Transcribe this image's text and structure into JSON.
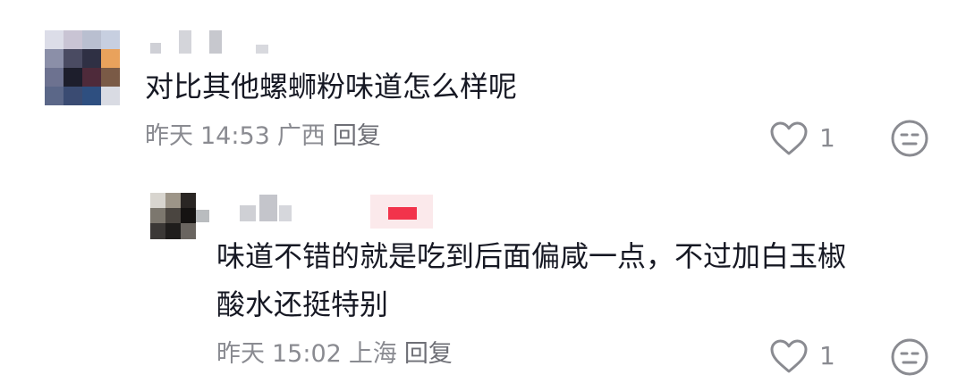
{
  "comments": [
    {
      "text": "对比其他螺蛳粉味道怎么样呢",
      "date": "昨天",
      "time": "14:53",
      "location": "广西",
      "reply_label": "回复",
      "likes": "1"
    },
    {
      "text_line1": "味道不错的就是吃到后面偏咸一点，不过加白玉椒",
      "text_line2": "酸水还挺特别",
      "date": "昨天",
      "time": "15:02",
      "location": "上海",
      "reply_label": "回复",
      "likes": "1"
    }
  ],
  "icons": {
    "like": "heart-outline-icon",
    "dislike": "neutral-face-icon"
  },
  "colors": {
    "text": "#161823",
    "meta": "#8a8b91",
    "badge": "#f2334b"
  }
}
